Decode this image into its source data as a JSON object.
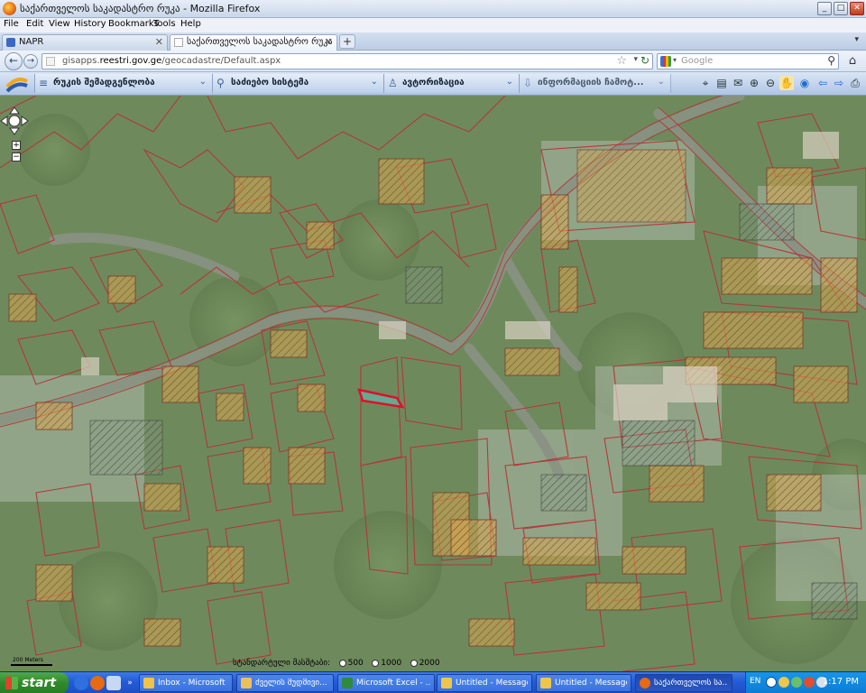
{
  "window": {
    "title": "საქართველოს საკადასტრო რუკა - Mozilla Firefox",
    "buttons": {
      "minimize": "_",
      "maximize": "□",
      "close": "✕"
    }
  },
  "menu": [
    "File",
    "Edit",
    "View",
    "History",
    "Bookmarks",
    "Tools",
    "Help"
  ],
  "tabs": [
    {
      "label": "NAPR",
      "active": false,
      "close": "✕"
    },
    {
      "label": "საქართველოს საკადასტრო რუკა",
      "active": true,
      "close": "✕"
    }
  ],
  "new_tab": "+",
  "tab_list": "▾",
  "nav": {
    "back": "←",
    "forward": "→",
    "url_prefix": "gisapps.",
    "url_host": "reestri.gov.ge",
    "url_path": "/geocadastre/Default.aspx",
    "bookmark_star": "☆",
    "url_dropdown": "▾",
    "reload": "↻",
    "search_engine_dropdown": "▾",
    "search_placeholder": "Google",
    "search_glass": "⚲",
    "home": "⌂"
  },
  "app_toolbar": {
    "dropdowns": [
      {
        "icon": "layers-icon",
        "glyph": "≡",
        "label": "რუკის შემადგენლობა",
        "chevron": "⌄"
      },
      {
        "icon": "search-icon",
        "glyph": "⚲",
        "label": "საძიებო სისტემა",
        "chevron": "⌄"
      },
      {
        "icon": "user-icon",
        "glyph": "♙",
        "label": "ავტორიზაცია",
        "chevron": "⌄"
      },
      {
        "icon": "download-icon",
        "glyph": "⇩",
        "label": "ინფორმაციის ჩამოტ...",
        "chevron": "⌄"
      }
    ],
    "tools": [
      {
        "name": "identify-tool-icon",
        "glyph": "⌖"
      },
      {
        "name": "document-tool-icon",
        "glyph": "▤"
      },
      {
        "name": "mail-tool-icon",
        "glyph": "✉"
      },
      {
        "name": "zoom-in-tool-icon",
        "glyph": "⊕"
      },
      {
        "name": "zoom-out-tool-icon",
        "glyph": "⊖"
      },
      {
        "name": "pan-hand-tool-icon",
        "glyph": "✋"
      },
      {
        "name": "globe-tool-icon",
        "glyph": "◉"
      },
      {
        "name": "previous-extent-icon",
        "glyph": "⇦"
      },
      {
        "name": "next-extent-icon",
        "glyph": "⇨"
      },
      {
        "name": "print-tool-icon",
        "glyph": "⎙"
      }
    ]
  },
  "map": {
    "zoom_in": "+",
    "zoom_out": "−",
    "scale_bar_label": "200 Meters",
    "scale_label": "სტანდარტული მასშტაბი:",
    "scale_options": [
      "500",
      "1000",
      "2000"
    ]
  },
  "taskbar": {
    "start": "start",
    "tasks": [
      {
        "label": "Inbox - Microsoft ...",
        "color": "#f2c24a",
        "active": false
      },
      {
        "label": "ძველის მუდმივი...",
        "color": "#e8c15e",
        "active": false
      },
      {
        "label": "Microsoft Excel - ...",
        "color": "#2f8a3b",
        "active": false
      },
      {
        "label": "Untitled - Message...",
        "color": "#f0c54b",
        "active": false
      },
      {
        "label": "Untitled - Message...",
        "color": "#f0c54b",
        "active": false
      },
      {
        "label": "საქართველოს სა...",
        "color": "#e86a10",
        "active": true
      }
    ],
    "lang": "EN",
    "clock": "1:17 PM"
  },
  "colors": {
    "highlight_parcel": "#e0102a",
    "parcel_line": "#b5343a",
    "hatch_fill": "#d4a04a"
  }
}
